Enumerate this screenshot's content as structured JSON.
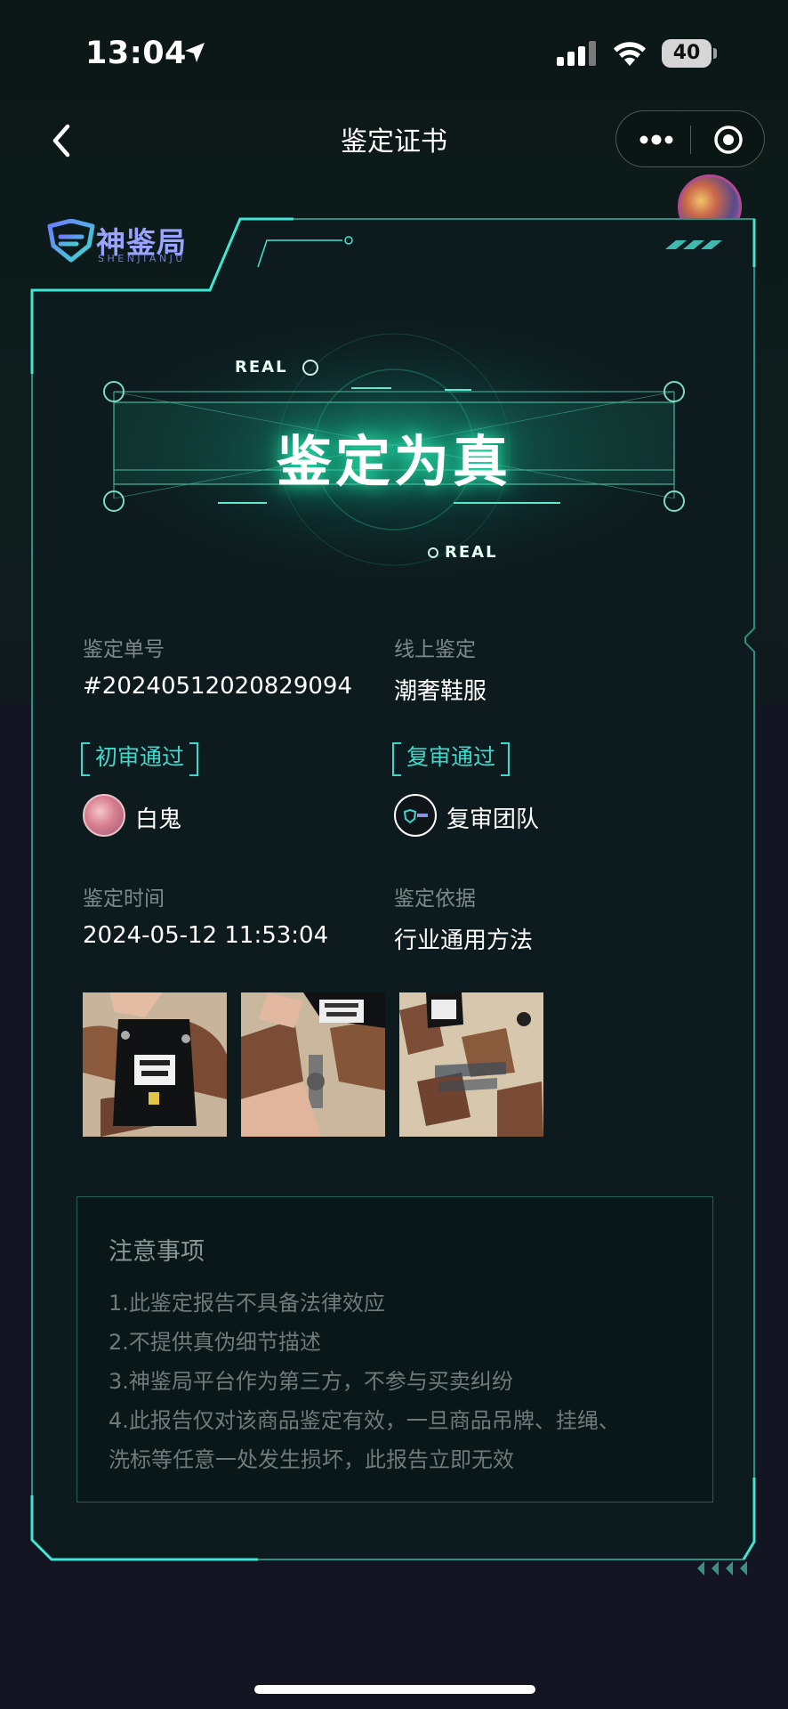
{
  "status_bar": {
    "time": "13:04",
    "battery": "40"
  },
  "nav": {
    "title": "鉴定证书"
  },
  "brand": {
    "name": "神鉴局",
    "subtitle": "SHENJIANJU"
  },
  "hero": {
    "tag_top": "REAL",
    "tag_bottom": "REAL",
    "result": "鉴定为真"
  },
  "info": {
    "order_label": "鉴定单号",
    "order_value": "#20240512020829094",
    "type_label": "线上鉴定",
    "type_value": "潮奢鞋服",
    "first_review_badge": "初审通过",
    "first_reviewer": "白鬼",
    "second_review_badge": "复审通过",
    "second_reviewer": "复审团队",
    "time_label": "鉴定时间",
    "time_value": "2024-05-12 11:53:04",
    "basis_label": "鉴定依据",
    "basis_value": "行业通用方法"
  },
  "notice": {
    "title": "注意事项",
    "items": [
      "1.此鉴定报告不具备法律效应",
      "2.不提供真伪细节描述",
      "3.神鉴局平台作为第三方，不参与买卖纠纷",
      "4.此报告仅对该商品鉴定有效，一旦商品吊牌、挂绳、",
      "洗标等任意一处发生损坏，此报告立即无效"
    ]
  },
  "colors": {
    "accent": "#3fd8cc",
    "glow": "#28ffbe",
    "brand": "#9aa3ff"
  },
  "icons": [
    "location-arrow-icon",
    "signal-icon",
    "wifi-icon",
    "back-icon",
    "more-icon",
    "close-target-icon",
    "shield-logo-icon"
  ]
}
